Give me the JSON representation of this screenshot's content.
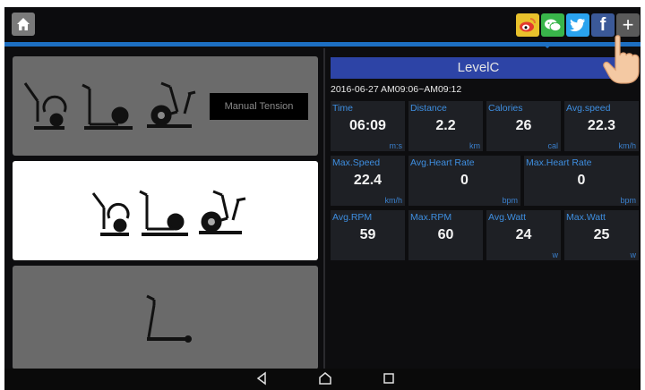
{
  "share_icons": {
    "weibo": {
      "name": "weibo-icon",
      "color": "#e8c12c"
    },
    "wechat": {
      "name": "wechat-icon",
      "color": "#39b54a"
    },
    "twitter": {
      "name": "twitter-icon",
      "color": "#2aa3ef",
      "glyph": "t"
    },
    "facebook": {
      "name": "facebook-icon",
      "color": "#3b5998",
      "glyph": "f"
    },
    "more": {
      "name": "plus-icon",
      "color": "#5a5a5a",
      "glyph": "+"
    }
  },
  "left_panel": {
    "manual_tension_label": "Manual Tension"
  },
  "workout": {
    "level": "LevelC",
    "session_time": "2016-06-27 AM09:06~AM09:12",
    "metrics_row1": [
      {
        "label": "Time",
        "value": "06:09",
        "unit": "m:s"
      },
      {
        "label": "Distance",
        "value": "2.2",
        "unit": "km"
      },
      {
        "label": "Calories",
        "value": "26",
        "unit": "cal"
      },
      {
        "label": "Avg.speed",
        "value": "22.3",
        "unit": "km/h"
      }
    ],
    "metrics_row2": [
      {
        "label": "Max.Speed",
        "value": "22.4",
        "unit": "km/h"
      },
      {
        "label": "Avg.Heart Rate",
        "value": "0",
        "unit": "bpm"
      },
      {
        "label": "Max.Heart Rate",
        "value": "0",
        "unit": "bpm"
      }
    ],
    "metrics_row3": [
      {
        "label": "Avg.RPM",
        "value": "59",
        "unit": ""
      },
      {
        "label": "Max.RPM",
        "value": "60",
        "unit": ""
      },
      {
        "label": "Avg.Watt",
        "value": "24",
        "unit": "w"
      },
      {
        "label": "Max.Watt",
        "value": "25",
        "unit": "w"
      }
    ]
  },
  "colors": {
    "accent_blue": "#1d6fc2",
    "level_bar": "#2d44a6",
    "metric_label": "#3e8ee0"
  }
}
